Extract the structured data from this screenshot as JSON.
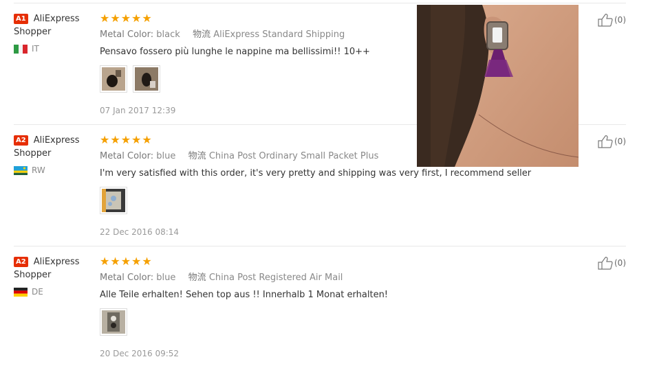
{
  "reviews": [
    {
      "badge": "A1",
      "name_line1": "AliExpress",
      "name_line2": "Shopper",
      "country": "IT",
      "stars": "★★★★★",
      "option_key": "Metal Color:",
      "option_val": "black",
      "ship_key": "物流",
      "ship_val": "AliExpress Standard Shipping",
      "text": "Pensavo fossero più lunghe le nappine ma bellissimi!! 10++",
      "date": "07 Jan 2017 12:39",
      "likes": "(0)"
    },
    {
      "badge": "A2",
      "name_line1": "AliExpress",
      "name_line2": "Shopper",
      "country": "RW",
      "stars": "★★★★★",
      "option_key": "Metal Color:",
      "option_val": "blue",
      "ship_key": "物流",
      "ship_val": "China Post Ordinary Small Packet Plus",
      "text": "I'm very satisfied with this order, it's very pretty and shipping was very first, I recommend seller",
      "date": "22 Dec 2016 08:14",
      "likes": "(0)"
    },
    {
      "badge": "A2",
      "name_line1": "AliExpress",
      "name_line2": "Shopper",
      "country": "DE",
      "stars": "★★★★★",
      "option_key": "Metal Color:",
      "option_val": "blue",
      "ship_key": "物流",
      "ship_val": "China Post Registered Air Mail",
      "text": "Alle Teile erhalten! Sehen top aus !! Innerhalb 1 Monat erhalten!",
      "date": "20 Dec 2016 09:52",
      "likes": "(0)"
    }
  ],
  "colors": {
    "star": "#f5a000",
    "badge": "#e62e04"
  },
  "icons": {
    "like": "thumbs-up-icon"
  }
}
